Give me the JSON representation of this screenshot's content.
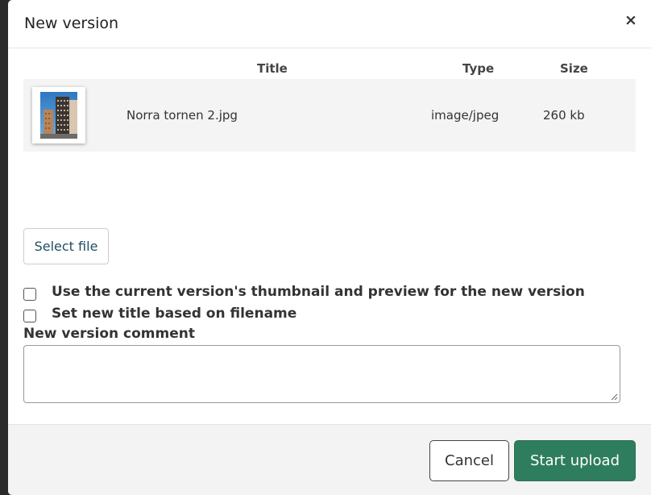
{
  "dialog": {
    "title": "New version",
    "close_symbol": "×"
  },
  "file_table": {
    "headers": {
      "title": "Title",
      "type": "Type",
      "size": "Size"
    },
    "rows": [
      {
        "thumbnail_icon": "image-thumbnail",
        "title": "Norra tornen 2.jpg",
        "type": "image/jpeg",
        "size": "260 kb"
      }
    ]
  },
  "select_file_label": "Select file",
  "options": [
    {
      "label": "Use the current version's thumbnail and preview for the new version",
      "checked": false
    },
    {
      "label": "Set new title based on filename",
      "checked": false
    }
  ],
  "comment": {
    "label": "New version comment",
    "value": ""
  },
  "footer": {
    "cancel_label": "Cancel",
    "upload_label": "Start upload"
  },
  "colors": {
    "primary": "#2e7d5e",
    "link_text": "#1d4e63"
  }
}
